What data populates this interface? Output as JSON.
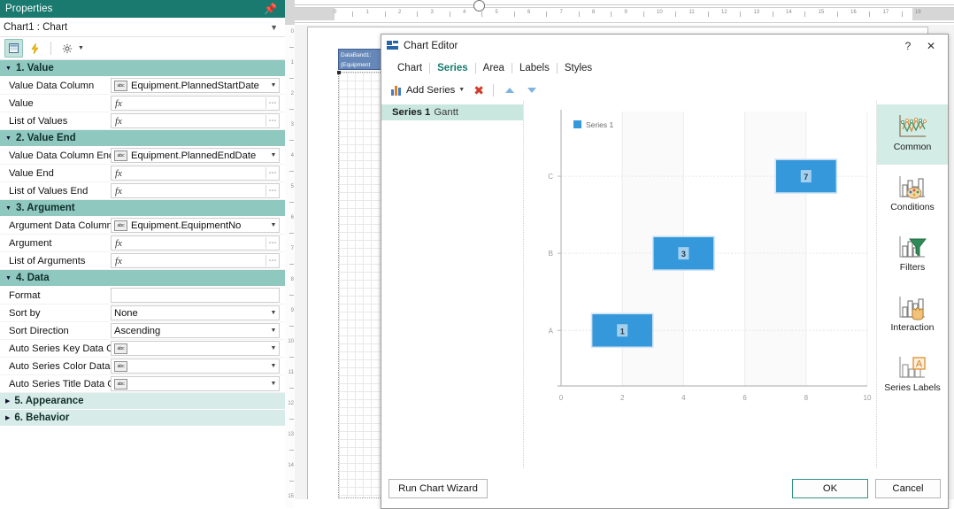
{
  "properties_panel": {
    "title": "Properties",
    "pin_icon": "pin-icon",
    "selected_object": "Chart1 : Chart",
    "toolbar": {
      "categorized_icon": "grid-icon",
      "events_icon": "lightning-icon",
      "settings_icon": "gear-icon"
    },
    "groups": [
      {
        "name": "1. Value",
        "collapsed": false,
        "rows": [
          {
            "label": "Value Data Column",
            "type": "datacolumn",
            "value": "Equipment.PlannedStartDate"
          },
          {
            "label": "Value",
            "type": "expression",
            "value": ""
          },
          {
            "label": "List of Values",
            "type": "expression",
            "value": ""
          }
        ]
      },
      {
        "name": "2. Value End",
        "collapsed": false,
        "rows": [
          {
            "label": "Value Data Column End",
            "type": "datacolumn",
            "value": "Equipment.PlannedEndDate"
          },
          {
            "label": "Value End",
            "type": "expression",
            "value": ""
          },
          {
            "label": "List of Values End",
            "type": "expression",
            "value": ""
          }
        ]
      },
      {
        "name": "3. Argument",
        "collapsed": false,
        "rows": [
          {
            "label": "Argument Data Column",
            "type": "datacolumn",
            "value": "Equipment.EquipmentNo"
          },
          {
            "label": "Argument",
            "type": "expression",
            "value": ""
          },
          {
            "label": "List of Arguments",
            "type": "expression",
            "value": ""
          }
        ]
      },
      {
        "name": "4. Data",
        "collapsed": false,
        "rows": [
          {
            "label": "Format",
            "type": "text",
            "value": ""
          },
          {
            "label": "Sort by",
            "type": "dropdown",
            "value": "None"
          },
          {
            "label": "Sort Direction",
            "type": "dropdown",
            "value": "Ascending"
          },
          {
            "label": "Auto Series Key Data Colur",
            "type": "datacolumn",
            "value": ""
          },
          {
            "label": "Auto Series Color Data Col",
            "type": "datacolumn",
            "value": ""
          },
          {
            "label": "Auto Series Title Data Colu",
            "type": "datacolumn",
            "value": ""
          }
        ]
      },
      {
        "name": "5. Appearance",
        "collapsed": true,
        "rows": []
      },
      {
        "name": "6. Behavior",
        "collapsed": true,
        "rows": []
      }
    ]
  },
  "design_surface": {
    "h_ruler_labels": [
      "0",
      "1",
      "2",
      "3",
      "4",
      "5",
      "6",
      "7",
      "8",
      "9",
      "10",
      "11",
      "12",
      "13",
      "14",
      "15",
      "16",
      "17",
      "18"
    ],
    "v_ruler_labels": [
      "0",
      "1",
      "2",
      "3",
      "4",
      "5",
      "6",
      "7",
      "8",
      "9",
      "10",
      "11",
      "12",
      "13",
      "14",
      "15"
    ],
    "band_label_line1": "DataBand1:",
    "band_label_line2": "{Equipment"
  },
  "dialog": {
    "title": "Chart Editor",
    "app_icon": "chart-editor-icon",
    "help_label": "?",
    "close_label": "✕",
    "tabs": [
      {
        "label": "Chart",
        "selected": false
      },
      {
        "label": "Series",
        "selected": true
      },
      {
        "label": "Area",
        "selected": false
      },
      {
        "label": "Labels",
        "selected": false
      },
      {
        "label": "Styles",
        "selected": false
      }
    ],
    "command_bar": {
      "add_series_label": "Add Series",
      "add_series_icon": "bar-chart-icon",
      "dropdown_icon": "chevron-down-icon",
      "delete_icon": "red-x-icon",
      "move_up_icon": "triangle-up-icon",
      "move_down_icon": "triangle-down-icon"
    },
    "series_list": [
      {
        "name": "Series 1",
        "type": "Gantt",
        "selected": true
      }
    ],
    "sidebar_items": [
      {
        "label": "Common",
        "icon": "line-chart-icon",
        "selected": true
      },
      {
        "label": "Conditions",
        "icon": "palette-chart-icon",
        "selected": false
      },
      {
        "label": "Filters",
        "icon": "funnel-icon",
        "selected": false
      },
      {
        "label": "Interaction",
        "icon": "hand-chart-icon",
        "selected": false
      },
      {
        "label": "Series Labels",
        "icon": "text-label-icon",
        "selected": false
      }
    ],
    "footer": {
      "wizard_label": "Run Chart Wizard",
      "ok_label": "OK",
      "cancel_label": "Cancel"
    }
  },
  "chart_data": {
    "type": "bar",
    "subtype": "gantt",
    "title": "",
    "xlabel": "",
    "ylabel": "",
    "categories": [
      "A",
      "B",
      "C"
    ],
    "x_ticks": [
      "0",
      "2",
      "4",
      "6",
      "8",
      "10"
    ],
    "xlim": [
      0,
      10
    ],
    "grid": true,
    "legend": {
      "position": "top-left",
      "entries": [
        "Series 1"
      ]
    },
    "series": [
      {
        "name": "Series 1",
        "color": "#3498db",
        "bars": [
          {
            "category": "A",
            "start": 1,
            "end": 3,
            "label": "1"
          },
          {
            "category": "B",
            "start": 3,
            "end": 5,
            "label": "3"
          },
          {
            "category": "C",
            "start": 7,
            "end": 9,
            "label": "7"
          }
        ]
      }
    ]
  },
  "colors": {
    "accent_teal": "#1a7a70",
    "group_header": "#8fc8bf",
    "group_header_collapsed": "#d7ece8",
    "bar_blue": "#3498db",
    "selection": "#c9e6df"
  }
}
